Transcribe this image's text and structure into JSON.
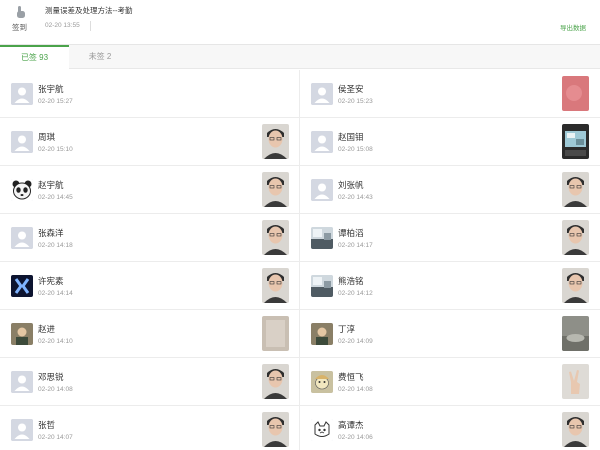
{
  "header": {
    "checkin_label": "签到",
    "title": "测量误差及处理方法--考勤",
    "time": "02-20 13:55",
    "export_label": "导出数据"
  },
  "tabs": [
    {
      "label": "已签 93",
      "active": true
    },
    {
      "label": "未签 2",
      "active": false
    }
  ],
  "colors": {
    "accent": "#4aa34a",
    "avatar_default": "#d4d8e2"
  },
  "records": [
    {
      "name": "张宇航",
      "time": "02-20 15:27",
      "avatar": "default-avatar-icon",
      "photo": "none"
    },
    {
      "name": "侯圣安",
      "time": "02-20 15:23",
      "avatar": "default-avatar-icon",
      "photo": "red-blurred-photo"
    },
    {
      "name": "周琪",
      "time": "02-20 15:10",
      "avatar": "default-avatar-icon",
      "photo": "face-photo"
    },
    {
      "name": "赵国钼",
      "time": "02-20 15:08",
      "avatar": "default-avatar-icon",
      "photo": "monitor-photo"
    },
    {
      "name": "赵宇航",
      "time": "02-20 14:45",
      "avatar": "panda-avatar-icon",
      "photo": "face-photo"
    },
    {
      "name": "刘张帆",
      "time": "02-20 14:43",
      "avatar": "default-avatar-icon",
      "photo": "face-photo"
    },
    {
      "name": "张森洋",
      "time": "02-20 14:18",
      "avatar": "default-avatar-icon",
      "photo": "face-photo"
    },
    {
      "name": "谭柏滔",
      "time": "02-20 14:17",
      "avatar": "landscape-avatar-icon",
      "photo": "face-photo"
    },
    {
      "name": "许宪素",
      "time": "02-20 14:14",
      "avatar": "x-logo-avatar-icon",
      "photo": "face-photo"
    },
    {
      "name": "熊浩铭",
      "time": "02-20 14:12",
      "avatar": "landscape-avatar-icon",
      "photo": "face-photo"
    },
    {
      "name": "赵进",
      "time": "02-20 14:10",
      "avatar": "person-avatar-icon",
      "photo": "blurred-photo"
    },
    {
      "name": "丁淳",
      "time": "02-20 14:09",
      "avatar": "person-avatar-icon",
      "photo": "room-photo"
    },
    {
      "name": "邓思锐",
      "time": "02-20 14:08",
      "avatar": "default-avatar-icon",
      "photo": "face-photo"
    },
    {
      "name": "费恒飞",
      "time": "02-20 14:08",
      "avatar": "cartoon-avatar-icon",
      "photo": "hand-photo"
    },
    {
      "name": "张哲",
      "time": "02-20 14:07",
      "avatar": "default-avatar-icon",
      "photo": "face-photo"
    },
    {
      "name": "高谭杰",
      "time": "02-20 14:06",
      "avatar": "cat-avatar-icon",
      "photo": "face-photo"
    }
  ]
}
